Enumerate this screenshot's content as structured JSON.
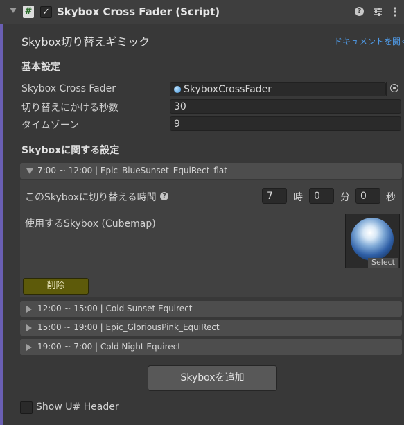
{
  "header": {
    "title": "Skybox Cross Fader (Script)",
    "script_icon": "#",
    "enabled_mark": "✓",
    "icons": [
      "help-icon",
      "preset-icon",
      "more-icon"
    ]
  },
  "gimmick": {
    "title": "Skybox切り替えギミック",
    "doc_link": "ドキュメントを開く"
  },
  "basic": {
    "heading": "基本設定",
    "fields": [
      {
        "label": "Skybox Cross Fader",
        "value": "SkyboxCrossFader"
      },
      {
        "label": "切り替えにかける秒数",
        "value": "30"
      },
      {
        "label": "タイムゾーン",
        "value": "9"
      }
    ]
  },
  "skybox": {
    "heading": "Skyboxに関する設定",
    "entries": [
      {
        "label": "7:00 ~ 12:00 | Epic_BlueSunset_EquiRect_flat",
        "expanded": true
      },
      {
        "label": "12:00 ~ 15:00 | Cold Sunset Equirect",
        "expanded": false
      },
      {
        "label": "15:00 ~ 19:00 | Epic_GloriousPink_EquiRect",
        "expanded": false
      },
      {
        "label": "19:00 ~ 7:00 | Cold Night Equirect",
        "expanded": false
      }
    ],
    "expanded": {
      "time_label": "このSkyboxに切り替える時間",
      "hour": "7",
      "hour_unit": "時",
      "minute": "0",
      "minute_unit": "分",
      "second": "0",
      "second_unit": "秒",
      "cubemap_label": "使用するSkybox (Cubemap)",
      "select_label": "Select",
      "delete_label": "削除"
    },
    "add_label": "Skyboxを追加"
  },
  "footer": {
    "show_header_label": "Show U# Header",
    "show_header_checked": false
  },
  "colors": {
    "accent": "#6a5fb3",
    "link": "#4f9be8",
    "delete_button": "#5d5a0a"
  }
}
